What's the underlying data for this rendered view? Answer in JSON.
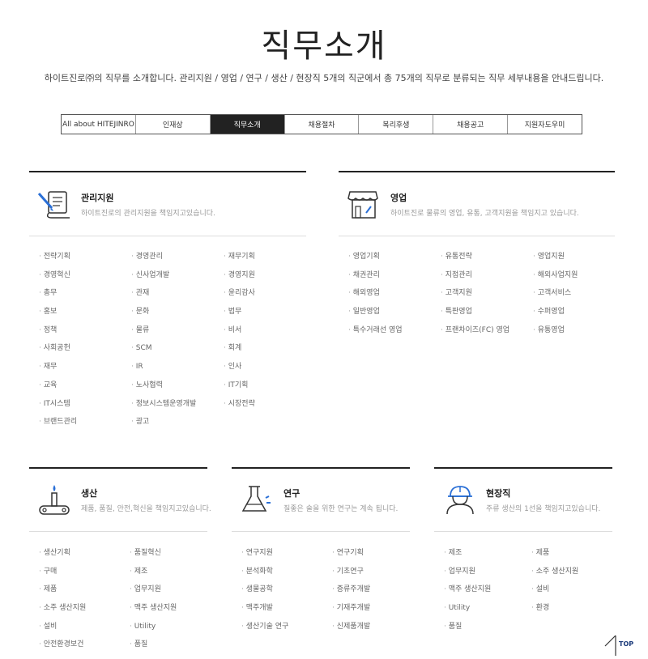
{
  "header": {
    "title": "직무소개",
    "subtitle": "하이트진로㈜의 직무를 소개합니다. 관리지원 / 영업 / 연구 / 생산 / 현장직 5개의 직군에서 총 75개의 직무로 분류되는 직무 세부내용을 안내드립니다."
  },
  "tabs": [
    {
      "label": "All about HITEJINRO"
    },
    {
      "label": "인재상"
    },
    {
      "label": "직무소개"
    },
    {
      "label": "채용절차"
    },
    {
      "label": "복리후생"
    },
    {
      "label": "채용공고"
    },
    {
      "label": "지원자도우미"
    }
  ],
  "sections": {
    "management": {
      "title": "관리지원",
      "desc": "하이트진로의 관리지원을 책임지고있습니다.",
      "icon": "document-pen-icon",
      "items": [
        "전략기획",
        "경영관리",
        "재무기획",
        "경영혁신",
        "신사업개발",
        "경영지원",
        "총무",
        "관재",
        "윤리감사",
        "홍보",
        "문화",
        "법무",
        "정책",
        "물류",
        "비서",
        "사회공헌",
        "SCM",
        "회계",
        "재무",
        "IR",
        "인사",
        "교육",
        "노사협력",
        "IT기획",
        "IT시스템",
        "정보시스템운영개발",
        "시장전략",
        "브랜드관리",
        "광고"
      ]
    },
    "sales": {
      "title": "영업",
      "desc": "하이트진로 물류의 영업, 유통, 고객지원을 책임지고 있습니다.",
      "icon": "store-icon",
      "items": [
        "영업기획",
        "유통전략",
        "영업지원",
        "채권관리",
        "지점관리",
        "해외사업지원",
        "해외영업",
        "고객지원",
        "고객서비스",
        "일반영업",
        "특판영업",
        "수퍼영업",
        "특수거래선 영업",
        "프랜차이즈(FC) 영업",
        "유통영업"
      ]
    },
    "production": {
      "title": "생산",
      "desc": "제품, 품질, 안전,혁신을 책임지고있습니다.",
      "icon": "conveyor-icon",
      "items": [
        "생산기획",
        "품질혁신",
        "구매",
        "제조",
        "제품",
        "업무지원",
        "소주 생산지원",
        "맥주 생산지원",
        "설비",
        "Utility",
        "안전환경보건",
        "품질"
      ]
    },
    "research": {
      "title": "연구",
      "desc": "질좋은 술을 위한 연구는 계속 됩니다.",
      "icon": "flask-icon",
      "items": [
        "연구지원",
        "연구기획",
        "분석화학",
        "기초연구",
        "생물공학",
        "증류주개발",
        "맥주개발",
        "기재주개발",
        "생산기술 연구",
        "신제품개발"
      ]
    },
    "field": {
      "title": "현장직",
      "desc": "주류 생산의 1선을 책임지고있습니다.",
      "icon": "worker-helmet-icon",
      "items": [
        "제조",
        "제품",
        "업무지원",
        "소주 생산지원",
        "맥주 생산지원",
        "설비",
        "Utility",
        "환경",
        "품질"
      ]
    }
  },
  "top_button": {
    "label": "TOP"
  },
  "colors": {
    "accent": "#2a6fd6",
    "dark": "#222222"
  }
}
